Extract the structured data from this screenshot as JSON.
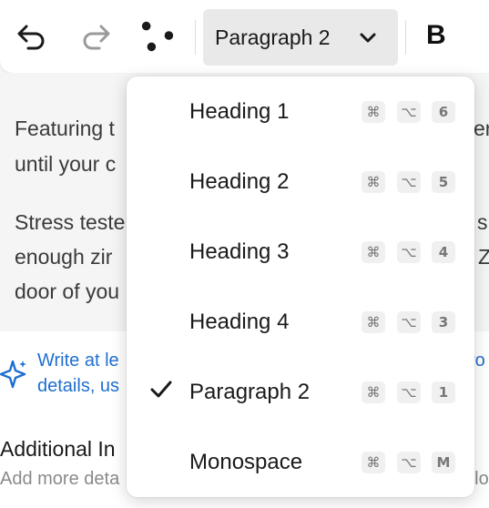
{
  "toolbar": {
    "undo_icon": "undo-arrow",
    "redo_icon": "redo-arrow",
    "more_icon": "dots",
    "style_value": "Paragraph 2",
    "bold_label": "B"
  },
  "content": {
    "para1_line1": "Featuring t",
    "para1_line1_end": "er",
    "para1_line2": "until your c",
    "para2_line1": "Stress teste",
    "para2_line1_end": "s",
    "para2_line2": "enough zir",
    "para2_line2_end": "Z",
    "para2_line3": "door of you",
    "ai_line1": "Write at le",
    "ai_line1_end": "ro",
    "ai_line2": "details, us",
    "additional_title": "Additional In",
    "additional_sub": "Add more deta",
    "additional_sub_end": "olo"
  },
  "menu": {
    "items": [
      {
        "label": "Heading 1",
        "key1": "⌘",
        "key2": "⌥",
        "key3": "6",
        "checked": false
      },
      {
        "label": "Heading 2",
        "key1": "⌘",
        "key2": "⌥",
        "key3": "5",
        "checked": false
      },
      {
        "label": "Heading 3",
        "key1": "⌘",
        "key2": "⌥",
        "key3": "4",
        "checked": false
      },
      {
        "label": "Heading 4",
        "key1": "⌘",
        "key2": "⌥",
        "key3": "3",
        "checked": false
      },
      {
        "label": "Paragraph 2",
        "key1": "⌘",
        "key2": "⌥",
        "key3": "1",
        "checked": true
      },
      {
        "label": "Monospace",
        "key1": "⌘",
        "key2": "⌥",
        "key3": "M",
        "checked": false
      }
    ]
  },
  "colors": {
    "accent_blue": "#1f6fd1",
    "select_bg": "#e9e9e9"
  }
}
